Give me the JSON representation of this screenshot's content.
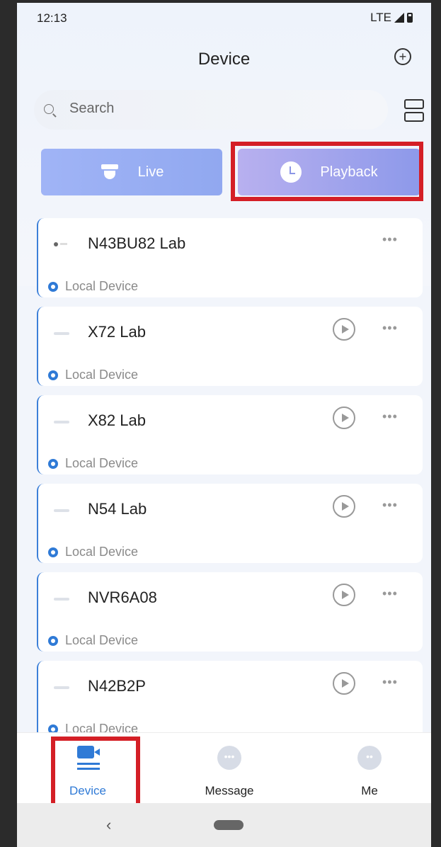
{
  "status_bar": {
    "time": "12:13",
    "network": "LTE"
  },
  "header": {
    "title": "Device"
  },
  "search": {
    "placeholder": "Search"
  },
  "modes": {
    "live_label": "Live",
    "playback_label": "Playback"
  },
  "devices": [
    {
      "name": "N43BU82 Lab",
      "type": "Local Device"
    },
    {
      "name": "X72 Lab",
      "type": "Local Device"
    },
    {
      "name": "X82 Lab",
      "type": "Local Device"
    },
    {
      "name": "N54 Lab",
      "type": "Local Device"
    },
    {
      "name": "NVR6A08",
      "type": "Local Device"
    },
    {
      "name": "N42B2P",
      "type": "Local Device"
    }
  ],
  "tabs": {
    "device": "Device",
    "message": "Message",
    "me": "Me"
  },
  "colors": {
    "accent": "#2f7ad6",
    "highlight": "#d41f26"
  }
}
